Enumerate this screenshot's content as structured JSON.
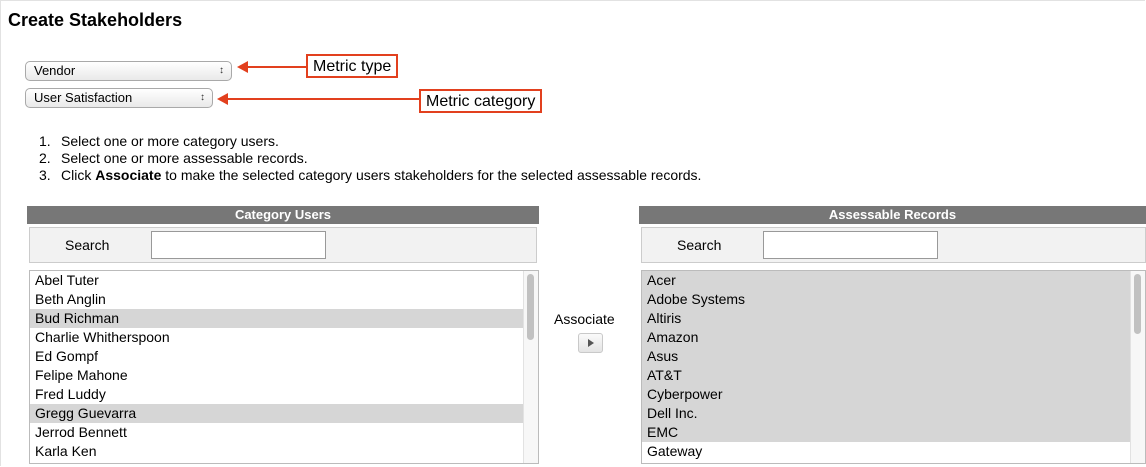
{
  "page": {
    "title": "Create Stakeholders"
  },
  "metric_type_select": {
    "value": "Vendor"
  },
  "metric_category_select": {
    "value": "User Satisfaction"
  },
  "callouts": {
    "metric_type": "Metric type",
    "metric_category": "Metric category"
  },
  "instructions": [
    {
      "num": "1.",
      "pre": "Select one or more category users.",
      "bold": "",
      "post": ""
    },
    {
      "num": "2.",
      "pre": "Select one or more assessable records.",
      "bold": "",
      "post": ""
    },
    {
      "num": "3.",
      "pre": "Click ",
      "bold": "Associate",
      "post": " to make the selected category users stakeholders for the selected assessable records."
    }
  ],
  "category_users": {
    "header": "Category Users",
    "search_label": "Search",
    "search_value": "",
    "items": [
      {
        "label": "Abel Tuter",
        "selected": false
      },
      {
        "label": "Beth Anglin",
        "selected": false
      },
      {
        "label": "Bud Richman",
        "selected": true
      },
      {
        "label": "Charlie Whitherspoon",
        "selected": false
      },
      {
        "label": "Ed Gompf",
        "selected": false
      },
      {
        "label": "Felipe Mahone",
        "selected": false
      },
      {
        "label": "Fred Luddy",
        "selected": false
      },
      {
        "label": "Gregg Guevarra",
        "selected": true
      },
      {
        "label": "Jerrod Bennett",
        "selected": false
      },
      {
        "label": "Karla Ken",
        "selected": false
      }
    ]
  },
  "associate": {
    "label": "Associate"
  },
  "assessable_records": {
    "header": "Assessable Records",
    "search_label": "Search",
    "search_value": "",
    "items": [
      {
        "label": "Acer",
        "selected": true
      },
      {
        "label": "Adobe Systems",
        "selected": true
      },
      {
        "label": "Altiris",
        "selected": true
      },
      {
        "label": "Amazon",
        "selected": true
      },
      {
        "label": "Asus",
        "selected": true
      },
      {
        "label": "AT&T",
        "selected": true
      },
      {
        "label": "Cyberpower",
        "selected": true
      },
      {
        "label": "Dell Inc.",
        "selected": true
      },
      {
        "label": "EMC",
        "selected": true
      },
      {
        "label": "Gateway",
        "selected": false
      }
    ]
  },
  "colors": {
    "callout_red": "#e2401e",
    "selected_row": "#d6d6d6",
    "panel_header": "#777777"
  }
}
